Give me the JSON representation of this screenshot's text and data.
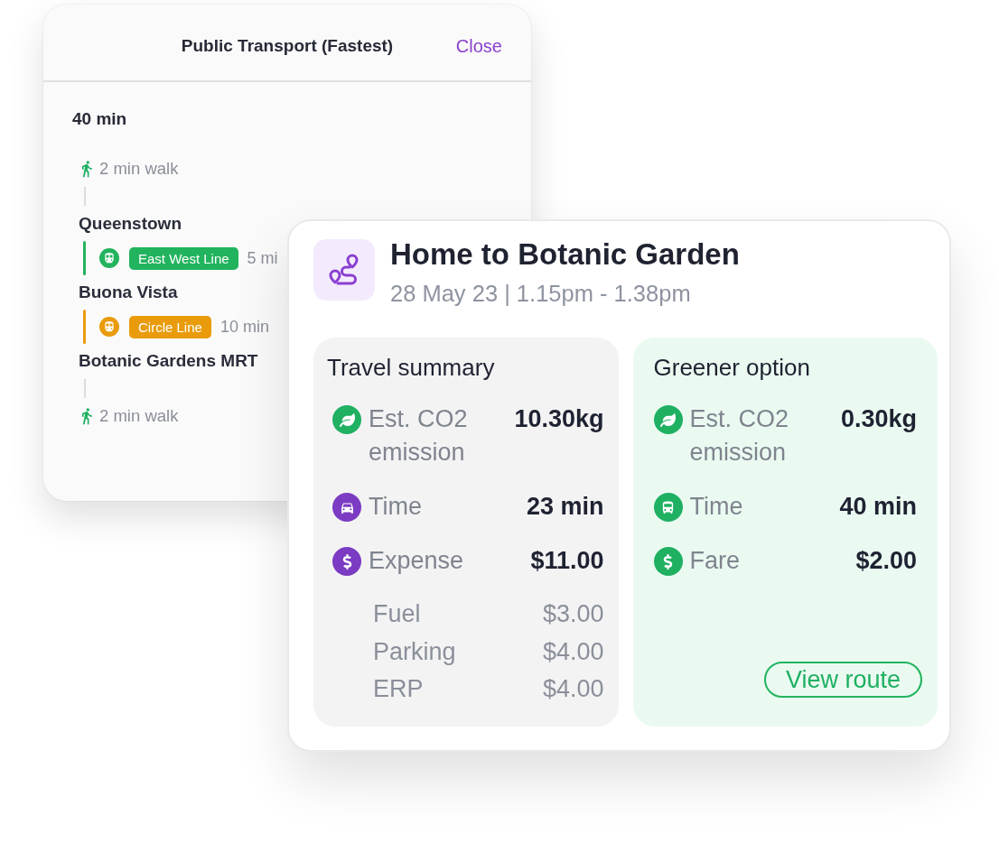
{
  "route_panel": {
    "title": "Public Transport (Fastest)",
    "close_label": "Close",
    "duration": "40 min",
    "steps": [
      {
        "kind": "walk",
        "text": "2 min walk"
      },
      {
        "kind": "stop",
        "name": "Queenstown"
      },
      {
        "kind": "ride",
        "line": "East West Line",
        "color": "#22b35e",
        "time": "5 mi"
      },
      {
        "kind": "stop",
        "name": "Buona Vista"
      },
      {
        "kind": "ride",
        "line": "Circle Line",
        "color": "#e99b0c",
        "time": "10 min"
      },
      {
        "kind": "stop",
        "name": "Botanic Gardens MRT"
      },
      {
        "kind": "walk",
        "text": "2 min walk"
      }
    ]
  },
  "trip_card": {
    "title": "Home to Botanic Garden",
    "subtitle": "28 May 23 | 1.15pm - 1.38pm",
    "panels": [
      {
        "kind": "summary",
        "title": "Travel summary",
        "metrics": [
          {
            "kind": "co2",
            "color": "#1fb062",
            "label": "Est. CO2 emission",
            "value": "10.30kg"
          },
          {
            "kind": "car",
            "color": "#7b3bc2",
            "label": "Time",
            "value": "23 min"
          },
          {
            "kind": "money",
            "color": "#7b3bc2",
            "label": "Expense",
            "value": "$11.00"
          }
        ],
        "breakdown": [
          {
            "label": "Fuel",
            "value": "$3.00"
          },
          {
            "label": "Parking",
            "value": "$4.00"
          },
          {
            "label": "ERP",
            "value": "$4.00"
          }
        ]
      },
      {
        "kind": "greener",
        "title": "Greener option",
        "metrics": [
          {
            "kind": "co2",
            "color": "#1fb062",
            "label": "Est. CO2 emission",
            "value": "0.30kg"
          },
          {
            "kind": "bus",
            "color": "#1fb062",
            "label": "Time",
            "value": "40 min"
          },
          {
            "kind": "money",
            "color": "#1fb062",
            "label": "Fare",
            "value": "$2.00"
          }
        ],
        "button": "View route"
      }
    ]
  }
}
